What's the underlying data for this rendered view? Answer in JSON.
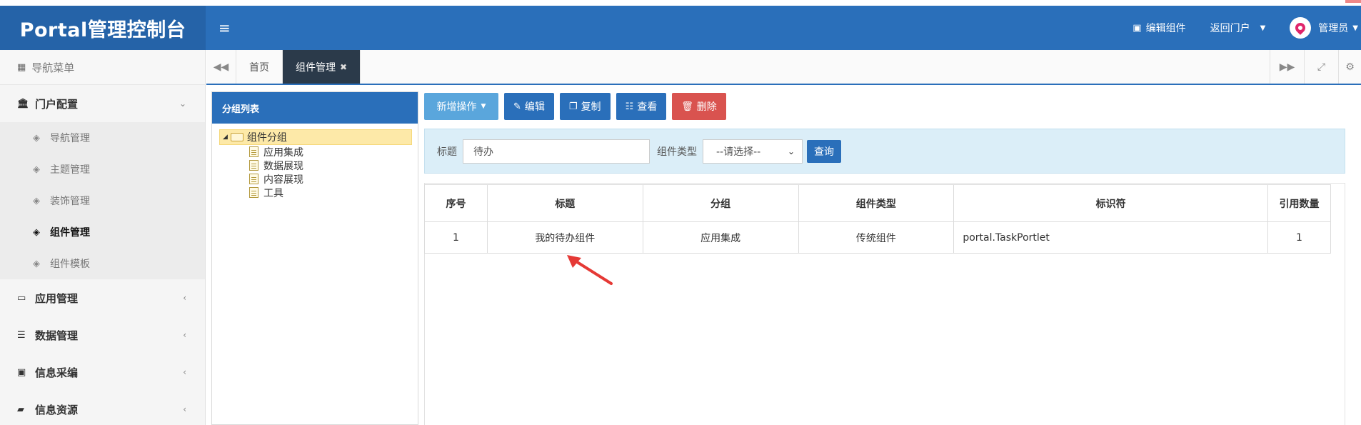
{
  "header": {
    "brand": "Portal管理控制台",
    "edit_component": "编辑组件",
    "back_portal": "返回门户",
    "user": "管理员"
  },
  "sidebar": {
    "title": "导航菜单",
    "groups": [
      {
        "label": "门户配置"
      },
      {
        "label": "应用管理"
      },
      {
        "label": "数据管理"
      },
      {
        "label": "信息采编"
      },
      {
        "label": "信息资源"
      }
    ],
    "sub_items": [
      {
        "label": "导航管理"
      },
      {
        "label": "主题管理"
      },
      {
        "label": "装饰管理"
      },
      {
        "label": "组件管理"
      },
      {
        "label": "组件模板"
      }
    ]
  },
  "tabs": [
    {
      "label": "首页"
    },
    {
      "label": "组件管理"
    }
  ],
  "group_panel": {
    "title": "分组列表",
    "root": "组件分组",
    "children": [
      "应用集成",
      "数据展现",
      "内容展现",
      "工具"
    ]
  },
  "toolbar": {
    "new": "新增操作",
    "edit": "编辑",
    "copy": "复制",
    "view": "查看",
    "delete": "删除"
  },
  "search": {
    "title_label": "标题",
    "title_value": "待办",
    "type_label": "组件类型",
    "type_selected": "--请选择--",
    "query_button": "查询"
  },
  "table": {
    "headers": [
      "序号",
      "标题",
      "分组",
      "组件类型",
      "标识符",
      "引用数量"
    ],
    "rows": [
      [
        "1",
        "我的待办组件",
        "应用集成",
        "传统组件",
        "portal.TaskPortlet",
        "1"
      ]
    ]
  },
  "colors": {
    "primary": "#2a6fba",
    "danger": "#d9534f",
    "light_blue": "#5aa6dc"
  }
}
